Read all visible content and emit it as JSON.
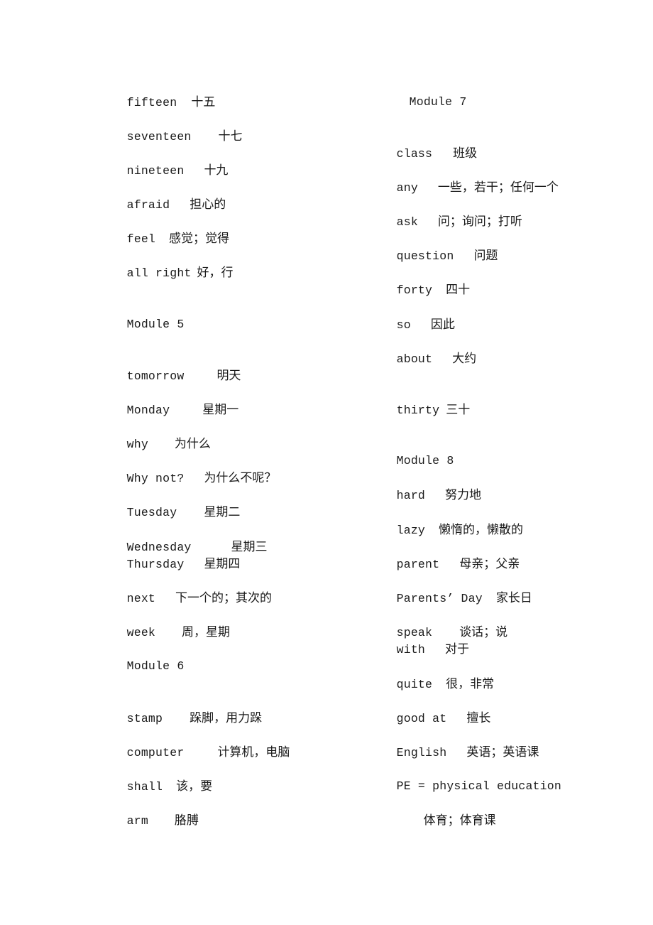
{
  "left_column": [
    {
      "en": "fifteen",
      "zh": "十五"
    },
    {
      "en": "seventeen",
      "zh": "十七"
    },
    {
      "en": "nineteen",
      "zh": "十九"
    },
    {
      "en": "afraid",
      "zh": "担心的"
    },
    {
      "en": "feel",
      "zh": "感觉；觉得"
    },
    {
      "en": "all right",
      "zh": "好，行"
    },
    {
      "heading": "Module 5"
    },
    {
      "en": "tomorrow",
      "zh": "明天"
    },
    {
      "en": "Monday",
      "zh": "星期一"
    },
    {
      "en": "why",
      "zh": "为什么"
    },
    {
      "en": "Why not?",
      "zh": "为什么不呢？"
    },
    {
      "en": "Tuesday",
      "zh": "星期二"
    },
    {
      "en": "Wednesday",
      "zh": "星期三"
    },
    {
      "en": "Thursday",
      "zh": "星期四"
    },
    {
      "en": "next",
      "zh": "下一个的；其次的"
    },
    {
      "en": "week",
      "zh": "周，星期"
    },
    {
      "heading": "Module 6"
    },
    {
      "en": "stamp",
      "zh": "跺脚，用力跺"
    },
    {
      "en": "computer",
      "zh": "计算机，电脑"
    },
    {
      "en": "shall",
      "zh": "该，要"
    },
    {
      "en": "arm",
      "zh": "胳膊"
    }
  ],
  "right_column": [
    {
      "heading": "Module 7"
    },
    {
      "en": "class",
      "zh": "班级"
    },
    {
      "en": "any",
      "zh": "一些，若干；任何一个"
    },
    {
      "en": "ask",
      "zh": "问；询问；打听"
    },
    {
      "en": "question",
      "zh": "问题"
    },
    {
      "en": "forty",
      "zh": "四十"
    },
    {
      "en": "so",
      "zh": "因此"
    },
    {
      "en": "about",
      "zh": "大约"
    },
    {
      "en": "thirty",
      "zh": "三十"
    },
    {
      "heading": "Module 8"
    },
    {
      "en": "hard",
      "zh": "努力地"
    },
    {
      "en": "lazy",
      "zh": "懒惰的，懒散的"
    },
    {
      "en": "parent",
      "zh": "母亲；父亲"
    },
    {
      "en": "Parents’ Day",
      "zh": "家长日"
    },
    {
      "en": "speak",
      "zh": "谈话；说"
    },
    {
      "en": "with",
      "zh": "对于"
    },
    {
      "en": "quite",
      "zh": "很，非常"
    },
    {
      "en": "good at",
      "zh": "擅长"
    },
    {
      "en": "English",
      "zh": "英语；英语课"
    },
    {
      "en": "PE = physical education",
      "zh": ""
    },
    {
      "en": "",
      "zh": "体育；体育课"
    }
  ]
}
